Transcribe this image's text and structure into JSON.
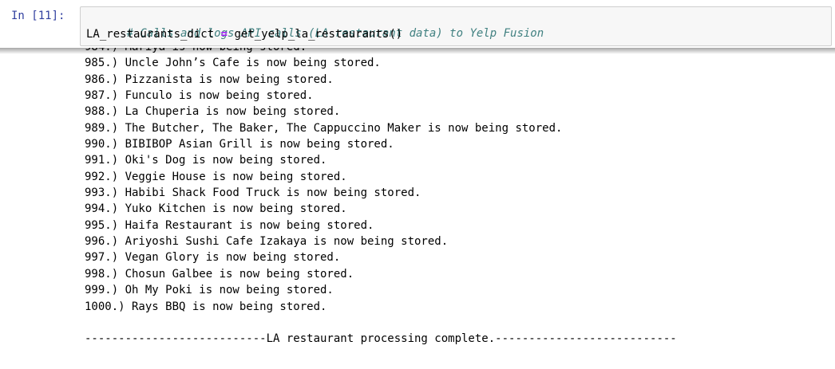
{
  "cell": {
    "prompt": "In [11]:",
    "code": {
      "comment": "# Calls and logs API calls (LA restaurant data) to Yelp Fusion",
      "var": "LA_restaurants_dict",
      "op": "=",
      "call": "get_yelp_la_restaurants()"
    }
  },
  "output": {
    "lines": [
      "984.) Mariya is now being stored.",
      "985.) Uncle John’s Cafe is now being stored.",
      "986.) Pizzanista is now being stored.",
      "987.) Funculo is now being stored.",
      "988.) La Chuperia is now being stored.",
      "989.) The Butcher, The Baker, The Cappuccino Maker is now being stored.",
      "990.) BIBIBOP Asian Grill is now being stored.",
      "991.) Oki's Dog is now being stored.",
      "992.) Veggie House is now being stored.",
      "993.) Habibi Shack Food Truck is now being stored.",
      "994.) Yuko Kitchen is now being stored.",
      "995.) Haifa Restaurant is now being stored.",
      "996.) Ariyoshi Sushi Cafe Izakaya is now being stored.",
      "997.) Vegan Glory is now being stored.",
      "998.) Chosun Galbee is now being stored.",
      "999.) Oh My Poki is now being stored.",
      "1000.) Rays BBQ is now being stored."
    ],
    "footer": "---------------------------LA restaurant processing complete.---------------------------"
  }
}
